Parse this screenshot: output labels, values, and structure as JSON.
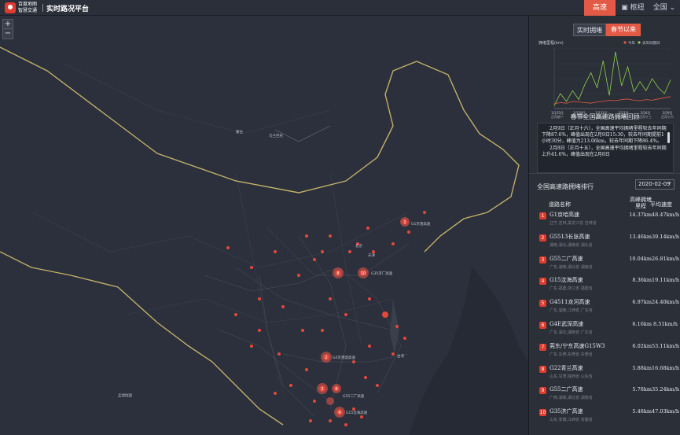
{
  "brand": {
    "line1": "百度地图",
    "line2": "智慧交通",
    "platform": "实时路况平台"
  },
  "topnav": {
    "highway": "高速",
    "hub": "枢纽",
    "region": "全国"
  },
  "map_labels": [
    {
      "text": "蒙古"
    },
    {
      "text": "乌兰巴托"
    },
    {
      "text": "北京"
    },
    {
      "text": "天津"
    },
    {
      "text": "G1京哈高速"
    },
    {
      "text": "G35济广高速"
    },
    {
      "text": "G15沈海高速"
    },
    {
      "text": "G4京港澳高速"
    },
    {
      "text": "G55二广高速"
    },
    {
      "text": "孟加拉国"
    },
    {
      "text": "台湾"
    }
  ],
  "toggle": {
    "live": "实时拥堵",
    "spring": "春节以来"
  },
  "chart_data": {
    "type": "line",
    "ylabel": "拥堵里程(km)",
    "series_names": [
      "今年",
      "去年同期日"
    ],
    "x_ticks": [
      "1月25日\n正月初一",
      "1月28日\n正月初四",
      "1月31日\n正月初七",
      "2月3日\n正月初十",
      "2月6日\n正月十三",
      "2月9日\n正月十六"
    ],
    "series": [
      {
        "name": "今年",
        "color": "#e25a45",
        "values": [
          8,
          10,
          9,
          12,
          11,
          10,
          9,
          11,
          12,
          14,
          13,
          15,
          16,
          14,
          13,
          15,
          14,
          16,
          18,
          20
        ]
      },
      {
        "name": "去年同期日",
        "color": "#8fd24d",
        "values": [
          5,
          25,
          12,
          30,
          15,
          40,
          60,
          35,
          80,
          22,
          95,
          38,
          70,
          28,
          45,
          30,
          50,
          35,
          25,
          48
        ]
      }
    ]
  },
  "chart_title": "春节全国高速路拥堵回顾",
  "review": {
    "p1": "2月9日（正月十六），全国高速平均拥堵里程较去年同期下降87.6%，峰值出现在2月9日15:30，较去年同期提前1小时30分，峰值为213.06km，较去年同期下降86.4%。",
    "p2": "2月8日（正月十五），全国高速平均拥堵里程较去年同期上升41.6%，峰值出现在2月8日"
  },
  "ranking": {
    "title": "全国高速路拥堵排行",
    "date": "2020-02-09",
    "col_name": "道路名称",
    "col_peak": "高峰拥堵里程",
    "col_speed": "平均速度",
    "rows": [
      {
        "rank": "1",
        "name": "G1京哈高速",
        "sub": "辽宁,吉林,黑龙江省 吉林省",
        "peak": "14.37km",
        "speed": "48.47km/h"
      },
      {
        "rank": "2",
        "name": "G5513长张高速",
        "sub": "湖南,湖北,湖南省 湖北省",
        "peak": "13.46km",
        "speed": "39.14km/h"
      },
      {
        "rank": "3",
        "name": "G55二广高速",
        "sub": "广东,湖南,湖北省 湖南省",
        "peak": "10.04km",
        "speed": "26.81km/h"
      },
      {
        "rank": "4",
        "name": "G15沈海高速",
        "sub": "广东,福建,浙江省 福建省",
        "peak": "8.36km",
        "speed": "19.11km/h"
      },
      {
        "rank": "5",
        "name": "G4511龙河高速",
        "sub": "广东,湖南,江西省 广东省",
        "peak": "6.97km",
        "speed": "24.40km/h"
      },
      {
        "rank": "6",
        "name": "G4E武深高速",
        "sub": "广东,湖北,湖南省 广东省",
        "peak": "6.16km",
        "speed": "8.51km/h"
      },
      {
        "rank": "7",
        "name": "莞东/宁东高速G15W3",
        "sub": "广东,东莞,东莞省 东莞省",
        "peak": "6.02km",
        "speed": "53.11km/h"
      },
      {
        "rank": "8",
        "name": "G22青兰高速",
        "sub": "山东,甘肃,陕西省 山东省",
        "peak": "5.88km",
        "speed": "16.68km/h"
      },
      {
        "rank": "9",
        "name": "G55二广高速",
        "sub": "广西,湖南,湖北省 湖南省",
        "peak": "5.78km",
        "speed": "35.24km/h"
      },
      {
        "rank": "10",
        "name": "G35济广高速",
        "sub": "山东,安徽,江西省 安徽省",
        "peak": "5.48km",
        "speed": "47.03km/h"
      }
    ]
  }
}
